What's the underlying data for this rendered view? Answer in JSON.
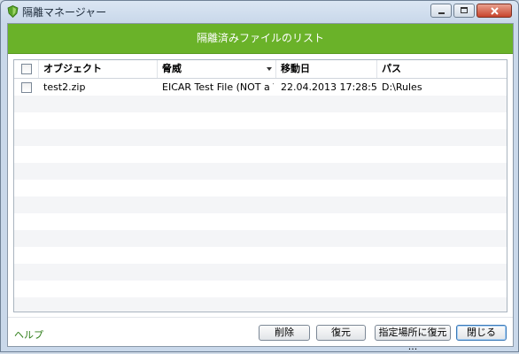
{
  "window": {
    "title": "隔離マネージャー"
  },
  "header": {
    "title": "隔離済みファイルのリスト"
  },
  "table": {
    "columns": [
      "オブジェクト",
      "脅威",
      "移動日",
      "パス"
    ],
    "rows": [
      {
        "object": "test2.zip",
        "threat": "EICAR Test File (NOT a Vir...",
        "date": "22.04.2013 17:28:53",
        "path": "D:\\Rules"
      }
    ]
  },
  "footer": {
    "help": "ヘルプ",
    "delete": "削除",
    "restore": "復元",
    "restore_to": "指定場所に復元 ...",
    "close": "閉じる"
  },
  "colors": {
    "header_green": "#6ab229",
    "help_link": "#2e7d18"
  }
}
